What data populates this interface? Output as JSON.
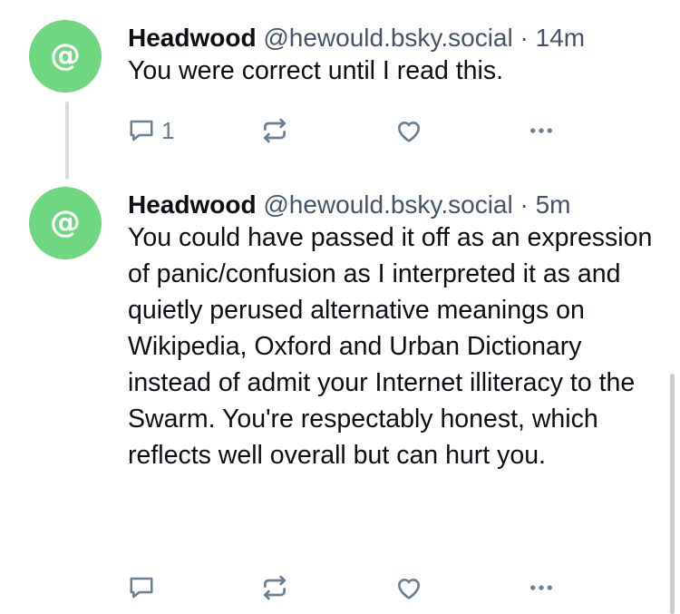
{
  "posts": [
    {
      "avatar_glyph": "@",
      "author": "Headwood",
      "handle": "@hewould.bsky.social",
      "separator": "·",
      "time": "14m",
      "text": "You were correct until I read this.",
      "actions": {
        "reply_count": "1",
        "icons": [
          "reply-icon",
          "repost-icon",
          "like-icon",
          "more-icon"
        ]
      }
    },
    {
      "avatar_glyph": "@",
      "author": "Headwood",
      "handle": "@hewould.bsky.social",
      "separator": "·",
      "time": "5m",
      "text": "You could have passed it off as an expression of panic/confusion as I interpreted it as and quietly perused alternative meanings on Wikipedia, Oxford and Urban Dictionary instead of admit your Internet illiteracy to the Swarm. You're respectably honest, which reflects well overall but can hurt you.",
      "actions": {
        "reply_count": "",
        "icons": [
          "reply-icon",
          "repost-icon",
          "like-icon",
          "more-icon"
        ]
      }
    }
  ],
  "colors": {
    "avatar_bg": "#6fd682",
    "text_primary": "#0b0f14",
    "text_secondary": "#44556a",
    "icon": "#6b7f95",
    "thread_line": "#d4dbe2"
  }
}
